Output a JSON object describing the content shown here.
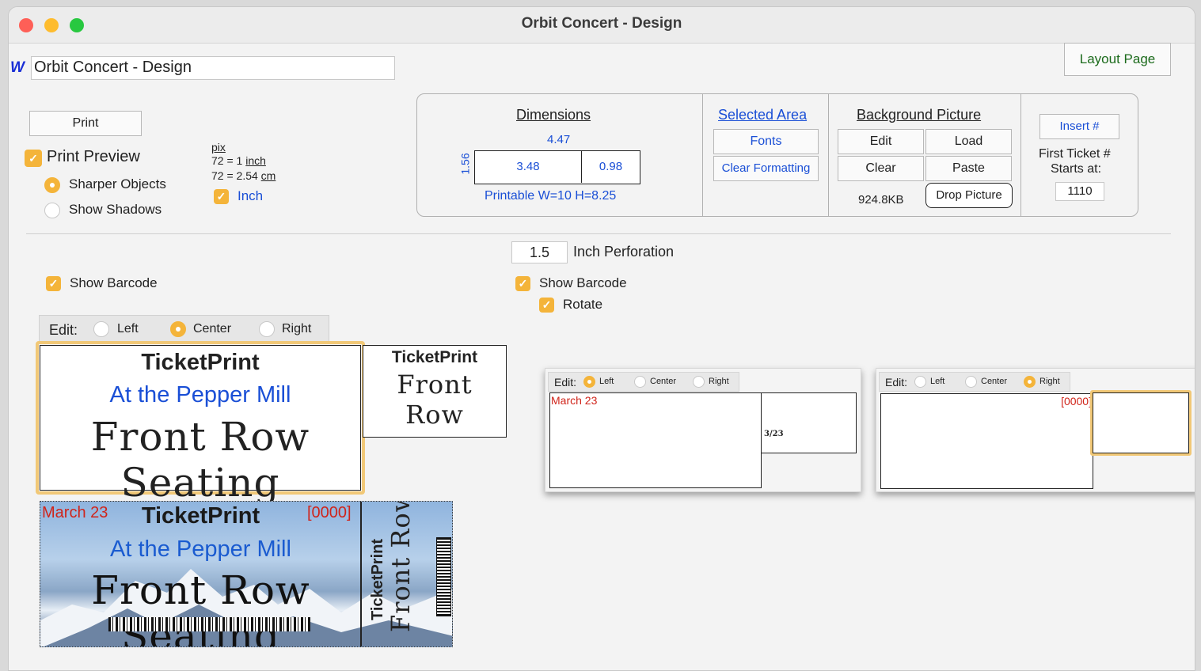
{
  "window": {
    "title": "Orbit Concert - Design",
    "name_field": "Orbit Concert - Design",
    "logo": "W"
  },
  "buttons": {
    "layout_page": "Layout Page",
    "print": "Print",
    "fonts": "Fonts",
    "clear_formatting": "Clear Formatting",
    "bg_edit": "Edit",
    "bg_load": "Load",
    "bg_clear": "Clear",
    "bg_paste": "Paste",
    "drop_picture": "Drop Picture",
    "insert_num": "Insert #"
  },
  "print_options": {
    "print_preview": "Print Preview",
    "sharper_objects": "Sharper Objects",
    "show_shadows": "Show Shadows",
    "pix": "pix",
    "inch_line_a": "72 = 1",
    "inch_word": "inch",
    "cm_line_a": "72 = 2.54",
    "cm_word": "cm",
    "inch_toggle": "Inch"
  },
  "dimensions": {
    "header": "Dimensions",
    "width": "4.47",
    "height": "1.56",
    "main": "3.48",
    "stub": "0.98",
    "printable": "Printable W=10 H=8.25"
  },
  "selected_area": {
    "header": "Selected Area"
  },
  "background": {
    "header": "Background Picture",
    "size": "924.8KB"
  },
  "numbering": {
    "first_ticket": "First Ticket #",
    "starts_at": "Starts at:",
    "start_value": "1110"
  },
  "perforation": {
    "value": "1.5",
    "label": "Inch Perforation"
  },
  "barcode": {
    "left": "Show Barcode",
    "right": "Show Barcode",
    "rotate": "Rotate"
  },
  "edit_bar": {
    "label": "Edit:",
    "left": "Left",
    "center": "Center",
    "right": "Right"
  },
  "ticket": {
    "brand": "TicketPrint",
    "venue": "At the Pepper Mill",
    "headline": "Front Row Seating",
    "stub_headline": "Front Row",
    "date": "March 23",
    "number": "[0000]",
    "stub_date": "3/23"
  },
  "colors": {
    "accent": "#f4b43a",
    "link": "#1a4fd6",
    "red": "#d0241a"
  }
}
